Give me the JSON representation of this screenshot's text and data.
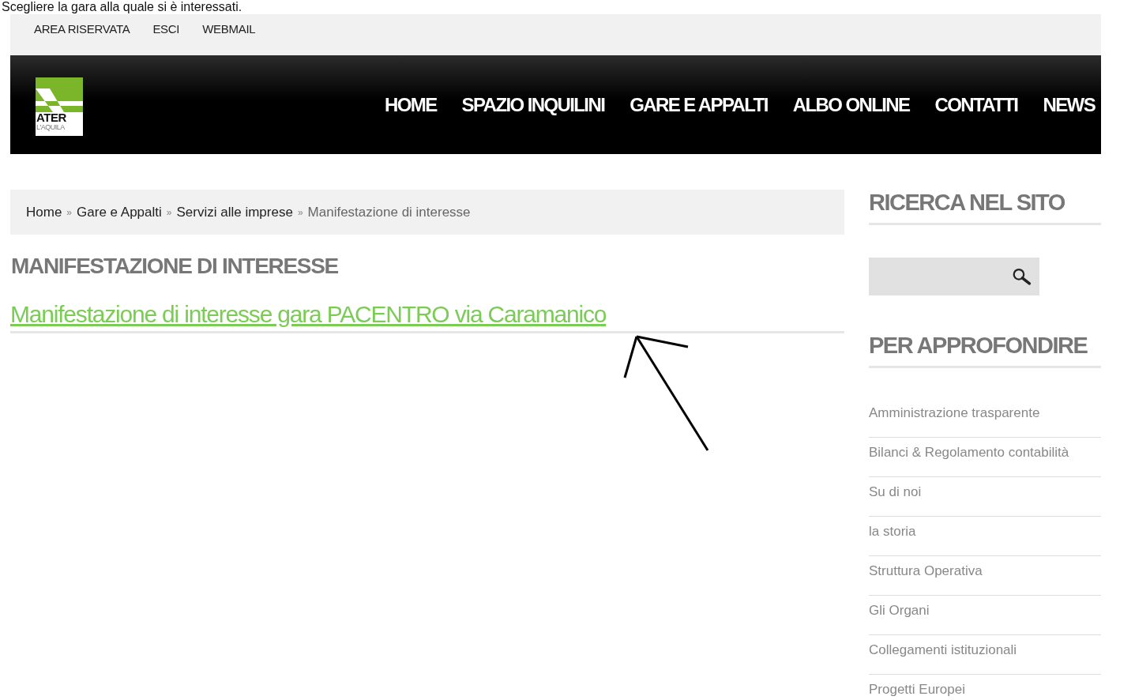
{
  "caption": "Scegliere la gara alla quale si è interessati.",
  "top_links": [
    "AREA RISERVATA",
    "ESCI",
    "WEBMAIL"
  ],
  "logo": {
    "title": "ATER",
    "subtitle": "L'AQUILA"
  },
  "menu": [
    "HOME",
    "SPAZIO INQUILINI",
    "GARE E APPALTI",
    "ALBO ONLINE",
    "CONTATTI",
    "NEWS"
  ],
  "breadcrumb": {
    "separator": "»",
    "items": [
      "Home",
      "Gare e Appalti",
      "Servizi alle imprese"
    ],
    "current": "Manifestazione di interesse"
  },
  "page_title": "MANIFESTAZIONE DI INTERESSE",
  "articles": [
    "Manifestazione di interesse gara PACENTRO via Caramanico"
  ],
  "sidebar": {
    "search_title": "RICERCA NEL SITO",
    "links_title": "PER APPROFONDIRE",
    "links": [
      "Amministrazione trasparente",
      "Bilanci & Regolamento contabilità",
      "Su di noi",
      "la storia",
      "Struttura Operativa",
      "Gli Organi",
      "Collegamenti istituzionali",
      "Progetti Europei"
    ]
  }
}
